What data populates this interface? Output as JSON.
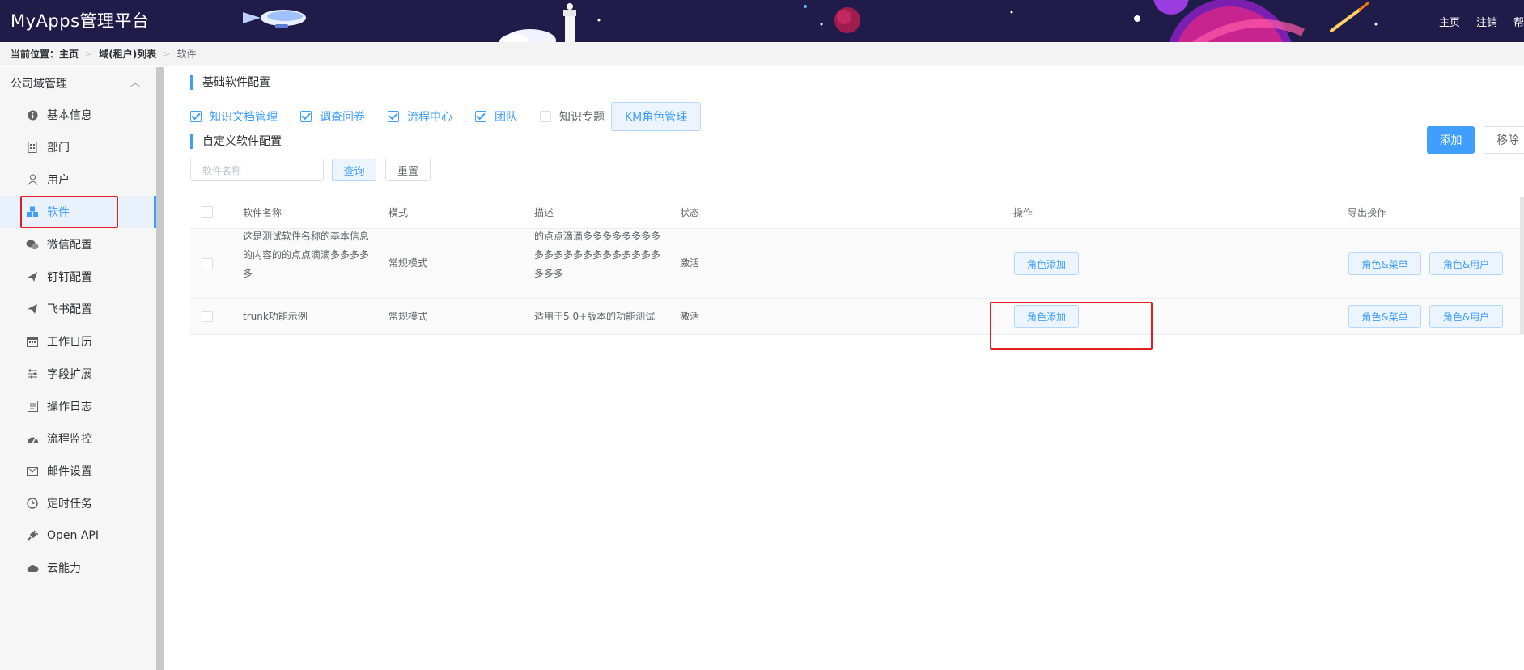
{
  "header": {
    "brand": "MyApps管理平台",
    "nav": [
      "主页",
      "注销",
      "帮"
    ]
  },
  "breadcrumb": {
    "label": "当前位置：",
    "items": [
      "主页",
      "域(租户)列表",
      "软件"
    ]
  },
  "sidebar": {
    "group_title": "公司域管理",
    "items": [
      {
        "label": "基本信息",
        "icon": "info-icon"
      },
      {
        "label": "部门",
        "icon": "building-icon"
      },
      {
        "label": "用户",
        "icon": "user-icon"
      },
      {
        "label": "软件",
        "icon": "cubes-icon",
        "active": true
      },
      {
        "label": "微信配置",
        "icon": "wechat-icon"
      },
      {
        "label": "钉钉配置",
        "icon": "plane-icon"
      },
      {
        "label": "飞书配置",
        "icon": "paper-plane-icon"
      },
      {
        "label": "工作日历",
        "icon": "calendar-icon"
      },
      {
        "label": "字段扩展",
        "icon": "sliders-icon"
      },
      {
        "label": "操作日志",
        "icon": "log-icon"
      },
      {
        "label": "流程监控",
        "icon": "dashboard-icon"
      },
      {
        "label": "邮件设置",
        "icon": "envelope-icon"
      },
      {
        "label": "定时任务",
        "icon": "clock-icon"
      },
      {
        "label": "Open API",
        "icon": "plug-icon"
      },
      {
        "label": "云能力",
        "icon": "cloud-icon"
      }
    ]
  },
  "basic_config": {
    "title": "基础软件配置",
    "options": [
      {
        "label": "知识文档管理",
        "checked": true
      },
      {
        "label": "调查问卷",
        "checked": true
      },
      {
        "label": "流程中心",
        "checked": true
      },
      {
        "label": "团队",
        "checked": true
      },
      {
        "label": "知识专题",
        "checked": false
      }
    ],
    "km_button": "KM角色管理"
  },
  "custom_config": {
    "title": "自定义软件配置",
    "search_placeholder": "软件名称",
    "query_button": "查询",
    "reset_button": "重置",
    "add_button": "添加",
    "remove_button": "移除"
  },
  "table": {
    "columns": [
      "软件名称",
      "模式",
      "描述",
      "状态",
      "操作",
      "导出操作"
    ],
    "rows": [
      {
        "name": "这是测试软件名称的基本信息的内容的的点点滴滴多多多多多",
        "mode": "常规模式",
        "desc": "的点点滴滴多多多多多多多多多多多多多多多多多多多多多多多多",
        "status": "激活",
        "action": "角色添加",
        "export": [
          "角色&菜单",
          "角色&用户"
        ]
      },
      {
        "name": "trunk功能示例",
        "mode": "常规模式",
        "desc": "适用于5.0+版本的功能测试",
        "status": "激活",
        "action": "角色添加",
        "export": [
          "角色&菜单",
          "角色&用户"
        ]
      }
    ]
  },
  "colors": {
    "accent": "#409eff",
    "header_bg": "#1f1c4a",
    "highlight": "#e02020"
  }
}
